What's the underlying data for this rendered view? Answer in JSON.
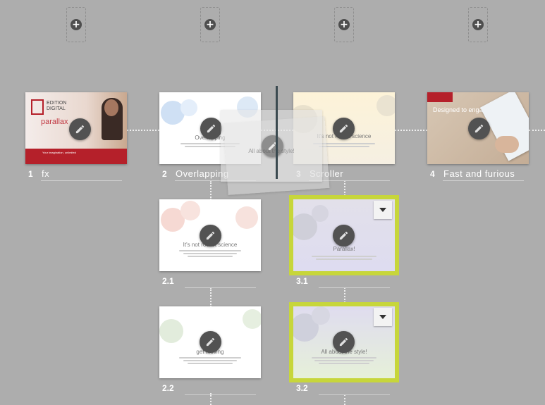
{
  "slides": [
    {
      "id": "1",
      "number": "1",
      "label": "fx",
      "card_title": "parallax",
      "logo_line1": "EDITION",
      "logo_line2": "DIGITAL",
      "tagline": "Your imagination, unlimited"
    },
    {
      "id": "2",
      "number": "2",
      "label": "Overlapping",
      "card_title": "Overlapping"
    },
    {
      "id": "3",
      "number": "3",
      "label": "Scroller",
      "card_title": "It's not rocket science"
    },
    {
      "id": "4",
      "number": "4",
      "label": "Fast and furious",
      "card_title": "Designed to engage"
    },
    {
      "id": "2.1",
      "number": "2.1",
      "label": "",
      "card_title": "It's not rocket science"
    },
    {
      "id": "2.2",
      "number": "2.2",
      "label": "",
      "card_title": "get moving"
    },
    {
      "id": "3.1",
      "number": "3.1",
      "label": "",
      "card_title": "Parallax!"
    },
    {
      "id": "3.2",
      "number": "3.2",
      "label": "",
      "card_title": "All about the style!"
    }
  ],
  "ghost_title": "All about the style!",
  "colors": {
    "background": "#adadad",
    "selection": "#c7d63b",
    "brand_red": "#b5202a",
    "edit_button": "#525252"
  },
  "icons": {
    "add": "plus-circle-icon",
    "edit": "pencil-icon",
    "dropdown": "caret-down-icon"
  }
}
